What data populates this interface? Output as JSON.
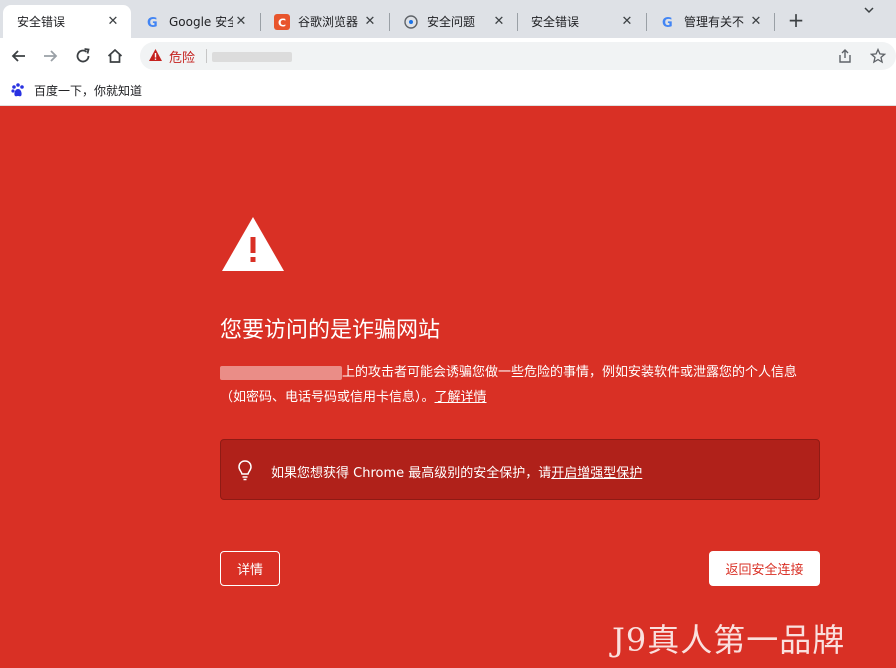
{
  "tabs": [
    {
      "title": "安全错误",
      "favicon": "none",
      "active": true
    },
    {
      "title": "Google 安全",
      "favicon": "google-g-icon",
      "active": false
    },
    {
      "title": "谷歌浏览器",
      "favicon": "orange-c-icon",
      "active": false
    },
    {
      "title": "安全问题",
      "favicon": "help-icon",
      "active": false
    },
    {
      "title": "安全错误",
      "favicon": "none",
      "active": false
    },
    {
      "title": "管理有关不",
      "favicon": "google-g-icon",
      "active": false
    }
  ],
  "new_tab_symbol": "+",
  "close_symbol": "✕",
  "omnibox": {
    "security_label": "危险",
    "url_text": ""
  },
  "bookmarks": [
    {
      "label": "百度一下，你就知道",
      "icon": "baidu-paw-icon"
    }
  ],
  "interstitial": {
    "heading": "您要访问的是诈骗网站",
    "body_text": "上的攻击者可能会诱骗您做一些危险的事情，例如安装软件或泄露您的个人信息（如密码、电话号码或信用卡信息）。",
    "learn_more": "了解详情",
    "enhanced_text": "如果您想获得 Chrome 最高级别的安全保护，请",
    "enhanced_link": "开启增强型保护",
    "details_button": "详情",
    "back_button": "返回安全连接"
  },
  "watermark": "J9真人第一品牌",
  "colors": {
    "danger_red": "#d93025",
    "tabstrip_gray": "#dee1e6",
    "enhanced_box": "#b0211a"
  }
}
